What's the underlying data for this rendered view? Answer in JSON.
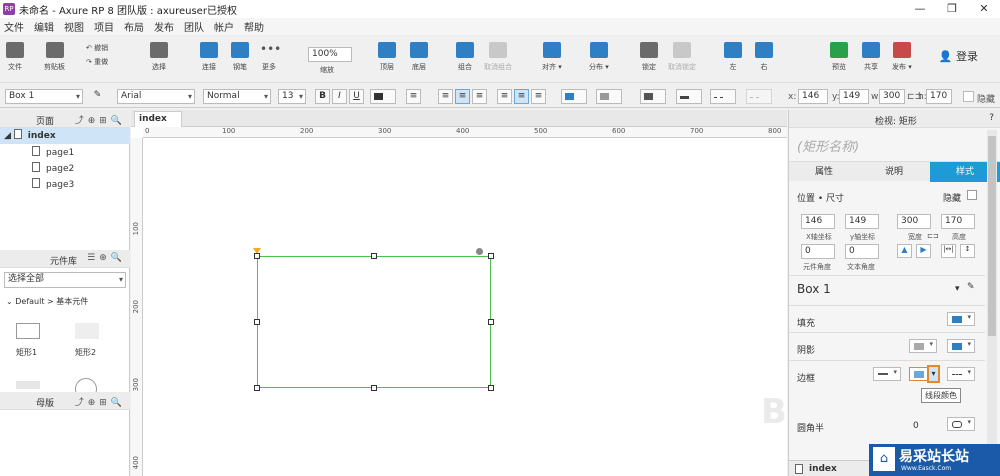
{
  "titlebar": {
    "title": "未命名 - Axure RP 8 团队版 : axureuser已授权",
    "app_icon": "RP"
  },
  "menu": [
    "文件",
    "编辑",
    "视图",
    "项目",
    "布局",
    "发布",
    "团队",
    "帐户",
    "帮助"
  ],
  "toolbar": {
    "file": "文件",
    "clipboard": "剪贴板",
    "undo": "撤销",
    "redo": "重做",
    "select": "选择",
    "connect": "连接",
    "pen": "钢笔",
    "more": "更多",
    "zoom_value": "100%",
    "zoom_label": "缩放",
    "top": "顶层",
    "bottom": "底层",
    "group": "组合",
    "ungroup": "取消组合",
    "align": "对齐",
    "distribute": "分布",
    "lock": "锁定",
    "unlock": "取消锁定",
    "left": "左",
    "right": "右",
    "preview": "预览",
    "share": "共享",
    "publish": "发布",
    "login": "登录"
  },
  "format": {
    "widget_name": "Box 1",
    "font": "Arial",
    "style": "Normal",
    "size": "13",
    "x_label": "x:",
    "x": "146",
    "y_label": "y:",
    "y": "149",
    "w_label": "w:",
    "w": "300",
    "h_label": "h:",
    "h": "170",
    "hide": "隐藏"
  },
  "pages_panel": {
    "title": "页面",
    "items": [
      "index",
      "page1",
      "page2",
      "page3"
    ]
  },
  "library_panel": {
    "title": "元件库",
    "filter": "选择全部",
    "group": "Default > 基本元件",
    "widgets": [
      "矩形1",
      "矩形2"
    ]
  },
  "masters_panel": {
    "title": "母版"
  },
  "canvas": {
    "tab": "index",
    "hruler": [
      "0",
      "100",
      "200",
      "300",
      "400",
      "500",
      "600",
      "700",
      "800"
    ],
    "vruler": [
      "100",
      "200",
      "300",
      "400"
    ]
  },
  "inspector": {
    "header": "检视: 矩形",
    "name_placeholder": "(矩形名称)",
    "tabs": [
      "属性",
      "说明",
      "样式"
    ],
    "position_size": "位置 • 尺寸",
    "hide": "隐藏",
    "x": "146",
    "y": "149",
    "w": "300",
    "h": "170",
    "x_cap": "X轴坐标",
    "y_cap": "y轴坐标",
    "w_cap": "宽度",
    "h_cap": "高度",
    "rot": "0",
    "rot_cap": "元件角度",
    "text_rot": "0",
    "text_rot_cap": "文本角度",
    "style_name": "Box 1",
    "fill": "填充",
    "shadow": "阴影",
    "border": "边框",
    "tooltip": "线段颜色",
    "radius": "圆角半",
    "radius_val": "0",
    "footer": "index",
    "accent": "#1e9bd7"
  },
  "watermark": {
    "brand": "易采站长站",
    "sub": "Www.Easck.Com"
  }
}
